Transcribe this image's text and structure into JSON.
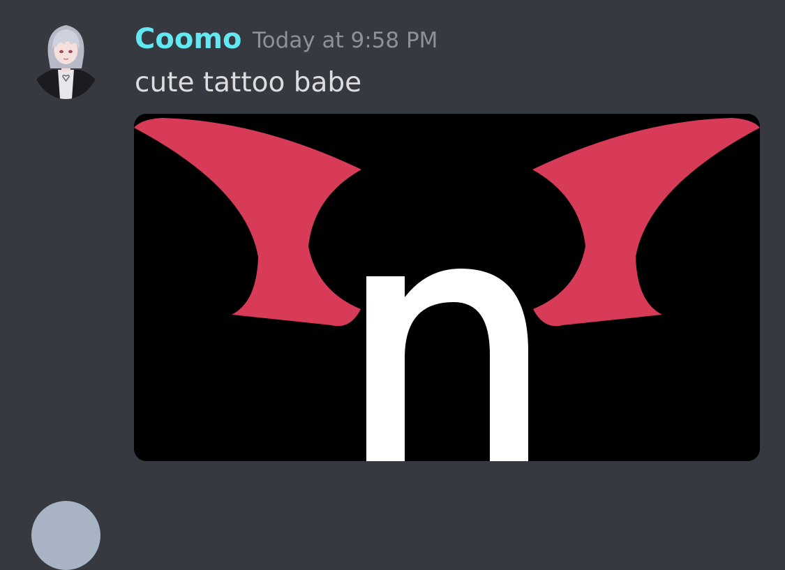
{
  "message": {
    "author": "Coomo",
    "timestamp": "Today at 9:58 PM",
    "text": "cute tattoo babe",
    "author_color": "#62e8f2"
  },
  "attachment": {
    "type": "image",
    "letter": "n",
    "wing_color": "#d83b58",
    "background_color": "#000000"
  },
  "theme": {
    "background": "#36393f",
    "text": "#dcddde",
    "muted": "#8e9297"
  }
}
